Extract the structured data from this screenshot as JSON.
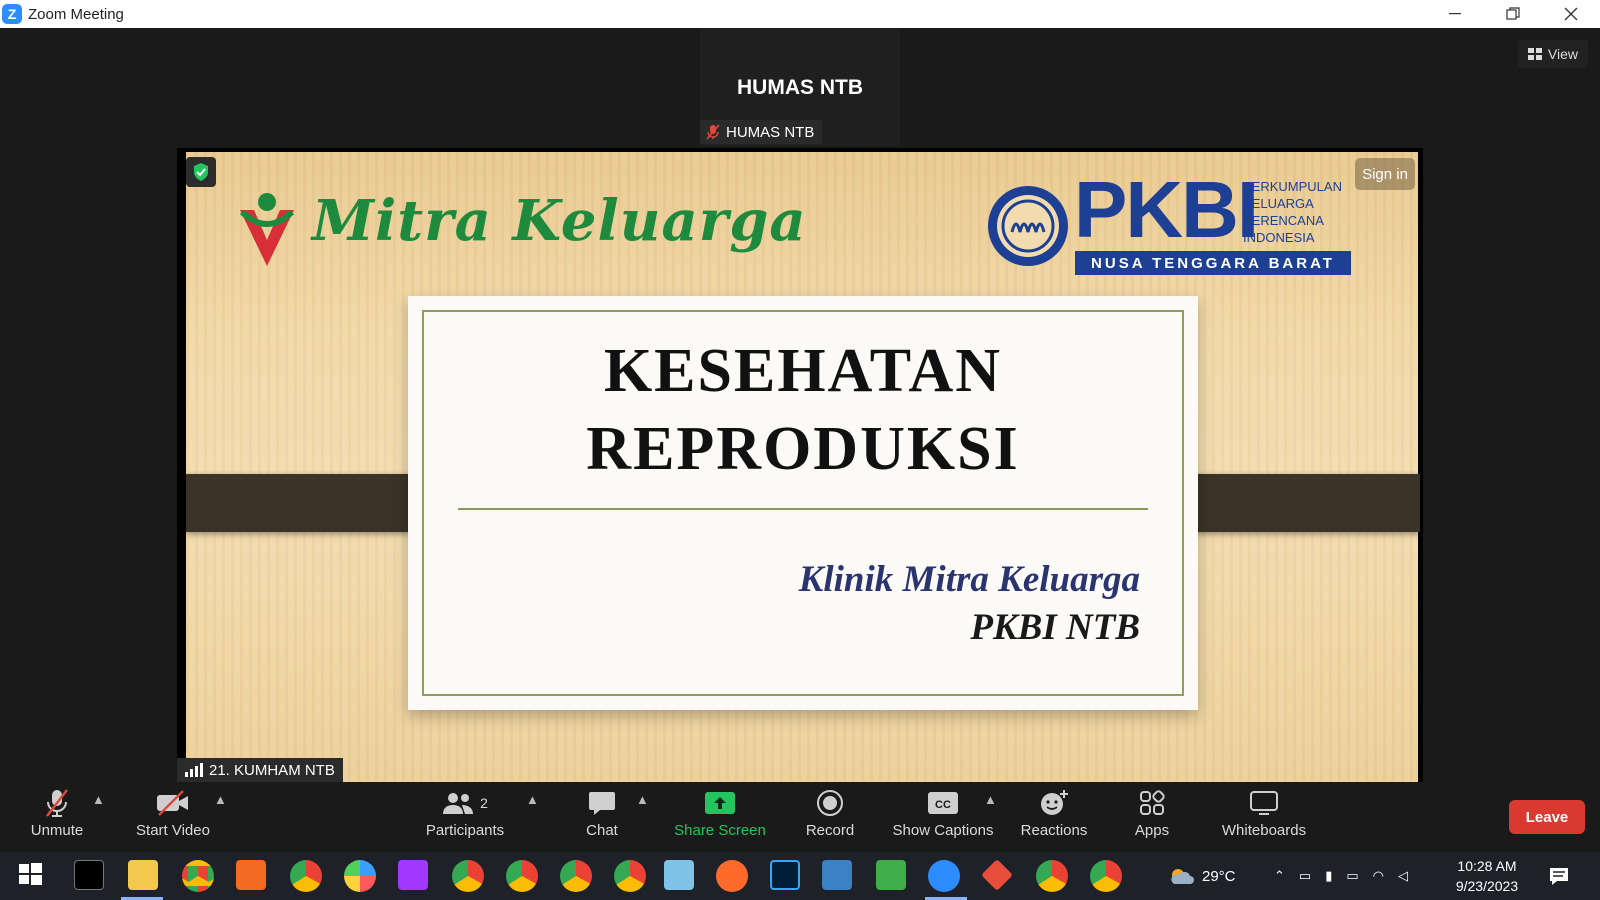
{
  "window": {
    "title": "Zoom Meeting",
    "controls": [
      "minimize",
      "restore",
      "close"
    ]
  },
  "meeting": {
    "active_speaker_name": "HUMAS NTB",
    "active_speaker_label": "HUMAS NTB",
    "view_label": "View",
    "sign_in_label": "Sign in",
    "presenter_label": "21. KUMHAM NTB"
  },
  "slide": {
    "logo_left_text": "Mitra Keluarga",
    "logo_right_text": "PKBI",
    "logo_right_sub": [
      "PERKUMPULAN",
      "KELUARGA",
      "BERENCANA",
      "INDONESIA"
    ],
    "logo_right_band": "NUSA TENGGARA BARAT",
    "title_line1": "KESEHATAN",
    "title_line2": "REPRODUKSI",
    "subtitle_line1": "Klinik Mitra Keluarga",
    "subtitle_line2": "PKBI NTB"
  },
  "toolbar": {
    "unmute": "Unmute",
    "start_video": "Start Video",
    "participants": "Participants",
    "participants_count": "2",
    "chat": "Chat",
    "share_screen": "Share Screen",
    "record": "Record",
    "show_captions": "Show Captions",
    "reactions": "Reactions",
    "apps": "Apps",
    "whiteboards": "Whiteboards",
    "leave": "Leave"
  },
  "taskbar": {
    "weather": "29°C",
    "time": "10:28 AM",
    "date": "9/23/2023"
  },
  "colors": {
    "zoom_blue": "#2d8cff",
    "leave_red": "#d93a30",
    "share_green": "#22c55e",
    "pkbi_blue": "#1d3f94",
    "mitra_green": "#1e8a3e"
  }
}
